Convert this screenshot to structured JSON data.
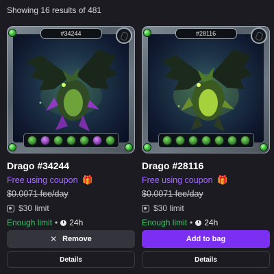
{
  "results_text": "Showing 16 results of 481",
  "cards": [
    {
      "tag": "#34244",
      "name": "Drago #34244",
      "coupon": "Free using coupon",
      "fee": "$0.0071 fee/day",
      "limit": "$30 limit",
      "status": "Enough limit",
      "time": "24h",
      "action_label": "Remove",
      "details_label": "Details"
    },
    {
      "tag": "#28116",
      "name": "Drago #28116",
      "coupon": "Free using coupon",
      "fee": "$0.0071 fee/day",
      "limit": "$30 limit",
      "status": "Enough limit",
      "time": "24h",
      "action_label": "Add to bag",
      "details_label": "Details"
    }
  ],
  "colors": {
    "background": "#1b1b21",
    "coupon": "#a36cff",
    "ok": "#3cc46a",
    "add_button": "#7b2ff2",
    "remove_button": "#34343d"
  },
  "icons": [
    "x-icon",
    "gift-icon",
    "limit-icon",
    "clock-icon",
    "ability-icon",
    "gem-icon"
  ]
}
